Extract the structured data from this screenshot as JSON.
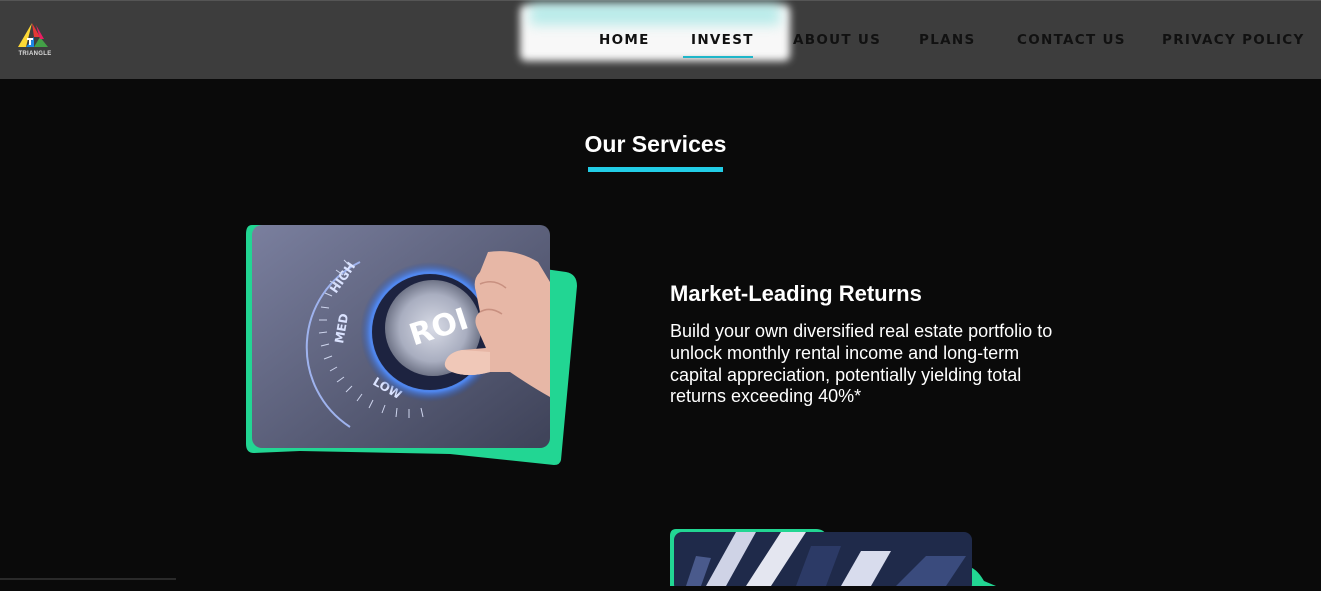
{
  "brand": {
    "logo_text": "TRIANGLE",
    "logo_colors": [
      "#e53935",
      "#fdd835",
      "#1e88e5",
      "#43a047"
    ]
  },
  "nav": {
    "items": [
      {
        "label": "HOME"
      },
      {
        "label": "INVEST"
      },
      {
        "label": "ABOUT US"
      },
      {
        "label": "PLANS"
      },
      {
        "label": "CONTACT US"
      },
      {
        "label": "PRIVACY POLICY"
      }
    ],
    "active": "INVEST"
  },
  "section": {
    "title": "Our Services",
    "accent_color": "#22cde6"
  },
  "services": [
    {
      "heading": "Market-Leading Returns",
      "description": "Build your own diversified real estate portfolio to unlock monthly rental income and long-term capital appreciation, potentially yielding total returns exceeding 40%*",
      "image": {
        "icon": "roi-dial-image",
        "dial_label": "ROI",
        "scale_labels": [
          "HIGH",
          "MED",
          "LOW"
        ]
      }
    },
    {
      "image": {
        "icon": "investment-photo-image"
      }
    }
  ],
  "colors": {
    "background": "#0a0a0a",
    "navbar": "#3d3d3d",
    "card_frame": "#22d693"
  }
}
